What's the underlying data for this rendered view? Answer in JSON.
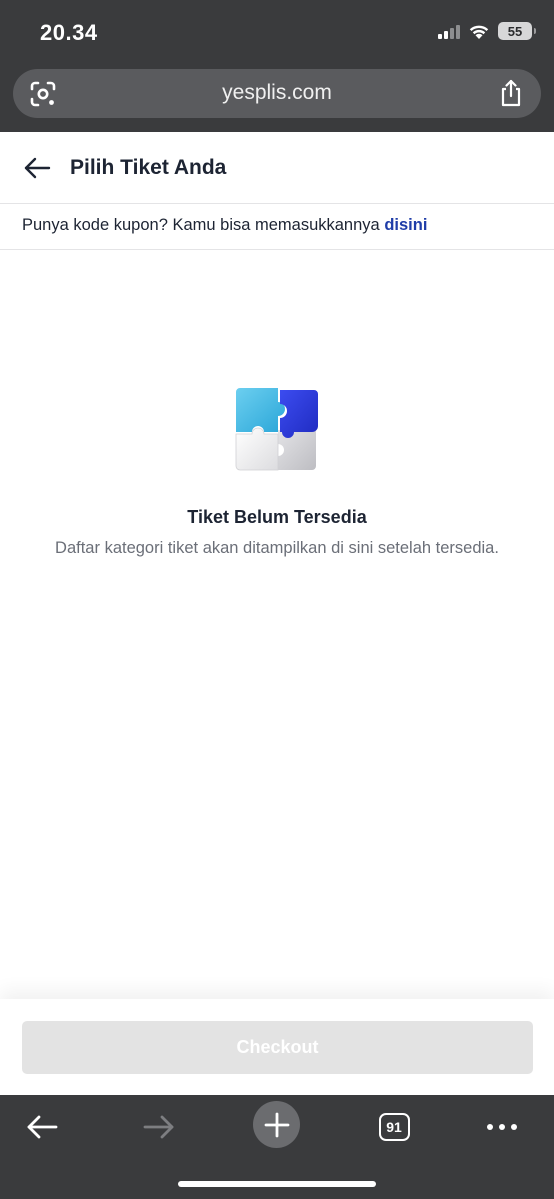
{
  "status_bar": {
    "time": "20.34",
    "battery": "55"
  },
  "browser": {
    "url": "yesplis.com",
    "tab_count": "91"
  },
  "header": {
    "title": "Pilih Tiket Anda"
  },
  "coupon": {
    "text": "Punya kode kupon? Kamu bisa memasukkannya ",
    "link": "disini"
  },
  "empty_state": {
    "title": "Tiket Belum Tersedia",
    "description": "Daftar kategori tiket akan ditampilkan di sini setelah tersedia."
  },
  "checkout": {
    "label": "Checkout",
    "enabled": false
  },
  "icons": {
    "lens": "google-lens-icon",
    "share": "share-icon",
    "back": "back-arrow-icon",
    "empty": "puzzle-illustration-icon"
  },
  "colors": {
    "chrome": "#3a3b3d",
    "link": "#1f3da8",
    "title_text": "#1d2433",
    "button_disabled": "#e3e3e3"
  }
}
